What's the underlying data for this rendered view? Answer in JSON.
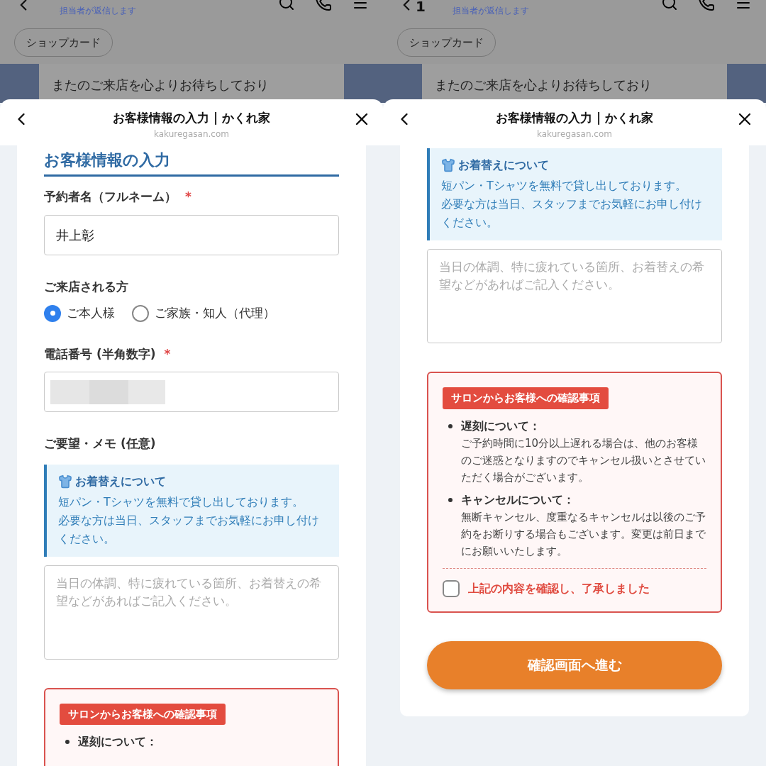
{
  "screens": [
    {
      "chat": {
        "subtitle": "担当者が返信します",
        "chip": "ショップカード",
        "message": "またのご来店を心よりお待ちしており"
      },
      "sheet": {
        "title": "お客様情報の入力 | かくれ家",
        "url": "kakuregasan.com"
      },
      "blocks": [
        {
          "kind": "heading",
          "text": "お客様情報の入力"
        },
        {
          "kind": "text_field",
          "label": "予約者名（フルネーム）",
          "required_mark": "*",
          "value": "井上彰"
        },
        {
          "kind": "radio_group",
          "label": "ご来店される方",
          "options": [
            {
              "label": "ご本人様",
              "selected": true
            },
            {
              "label": "ご家族・知人（代理）",
              "selected": false
            }
          ]
        },
        {
          "kind": "text_field",
          "label": "電話番号 (半角数字)",
          "required_mark": "*",
          "redacted": true
        },
        {
          "kind": "label",
          "text": "ご要望・メモ (任意)"
        },
        {
          "kind": "info_note",
          "title": "お着替えについて",
          "lines": [
            "短パン・Tシャツを無料で貸し出しております。",
            "必要な方は当日、スタッフまでお気軽にお申し付けください。"
          ]
        },
        {
          "kind": "textarea",
          "placeholder": "当日の体調、特に疲れている箇所、お着替えの希望などがあればご記入ください。"
        },
        {
          "kind": "confirm_box",
          "badge": "サロンからお客様への確認事項",
          "items": [
            {
              "title": "遅刻について："
            }
          ]
        }
      ]
    },
    {
      "chat": {
        "unread_count": "1",
        "subtitle": "担当者が返信します",
        "chip": "ショップカード",
        "message": "またのご来店を心よりお待ちしており"
      },
      "sheet": {
        "title": "お客様情報の入力 | かくれ家",
        "url": "kakuregasan.com"
      },
      "blocks": [
        {
          "kind": "info_note",
          "title": "お着替えについて",
          "lines": [
            "短パン・Tシャツを無料で貸し出しております。",
            "必要な方は当日、スタッフまでお気軽にお申し付けください。"
          ]
        },
        {
          "kind": "textarea",
          "placeholder": "当日の体調、特に疲れている箇所、お着替えの希望などがあればご記入ください。"
        },
        {
          "kind": "confirm_box",
          "badge": "サロンからお客様への確認事項",
          "items": [
            {
              "title": "遅刻について：",
              "body": "ご予約時間に10分以上遅れる場合は、他のお客様のご迷惑となりますのでキャンセル扱いとさせていただく場合がございます。"
            },
            {
              "title": "キャンセルについて：",
              "body": "無断キャンセル、度重なるキャンセルは以後のご予約をお断りする場合もございます。変更は前日までにお願いいたします。"
            }
          ],
          "agree": {
            "label": "上記の内容を確認し、了承しました",
            "checked": false
          }
        },
        {
          "kind": "submit_button",
          "label": "確認画面へ進む"
        }
      ]
    }
  ]
}
